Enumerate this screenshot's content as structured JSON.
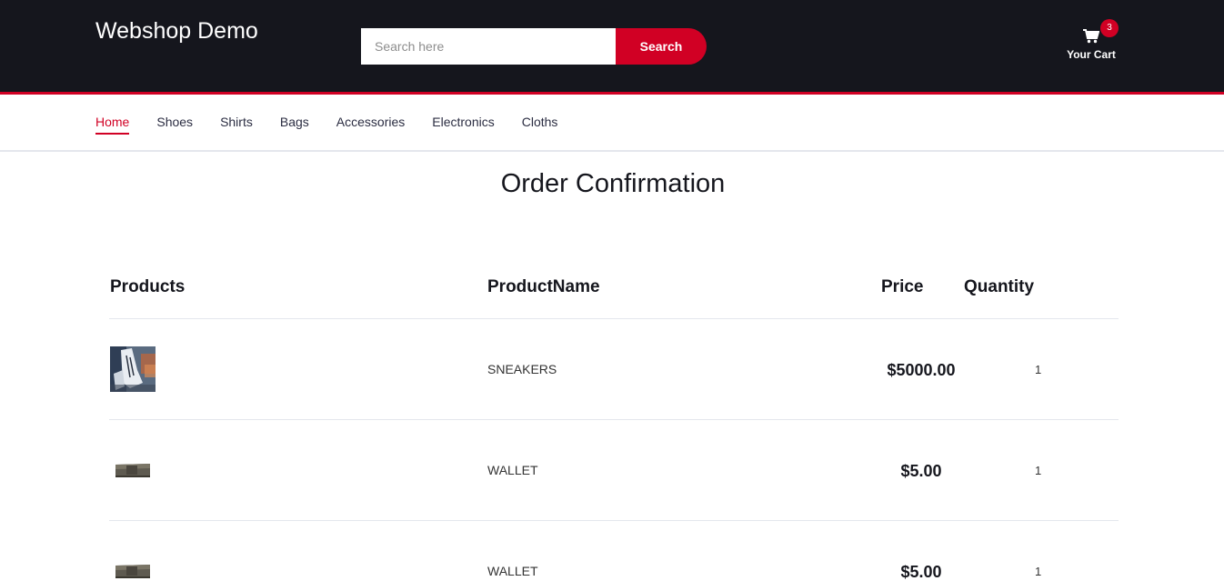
{
  "header": {
    "logo": "Webshop Demo",
    "search_placeholder": "Search here",
    "search_button": "Search",
    "cart_label": "Your Cart",
    "cart_count": "3",
    "cart_icon": "shopping-cart-icon"
  },
  "nav": {
    "items": [
      {
        "label": "Home",
        "active": true
      },
      {
        "label": "Shoes"
      },
      {
        "label": "Shirts"
      },
      {
        "label": "Bags"
      },
      {
        "label": "Accessories"
      },
      {
        "label": "Electronics"
      },
      {
        "label": "Cloths"
      }
    ]
  },
  "page": {
    "title": "Order Confirmation"
  },
  "table": {
    "headers": {
      "products": "Products",
      "name": "ProductName",
      "price": "Price",
      "quantity": "Quantity"
    },
    "rows": [
      {
        "image": "sneakers-image",
        "name": "SNEAKERS",
        "price": "$5000.00",
        "quantity": "1"
      },
      {
        "image": "wallet-image",
        "name": "WALLET",
        "price": "$5.00",
        "quantity": "1"
      },
      {
        "image": "wallet-image",
        "name": "WALLET",
        "price": "$5.00",
        "quantity": "1"
      }
    ]
  },
  "colors": {
    "accent": "#d10024",
    "header_bg": "#15161d"
  }
}
